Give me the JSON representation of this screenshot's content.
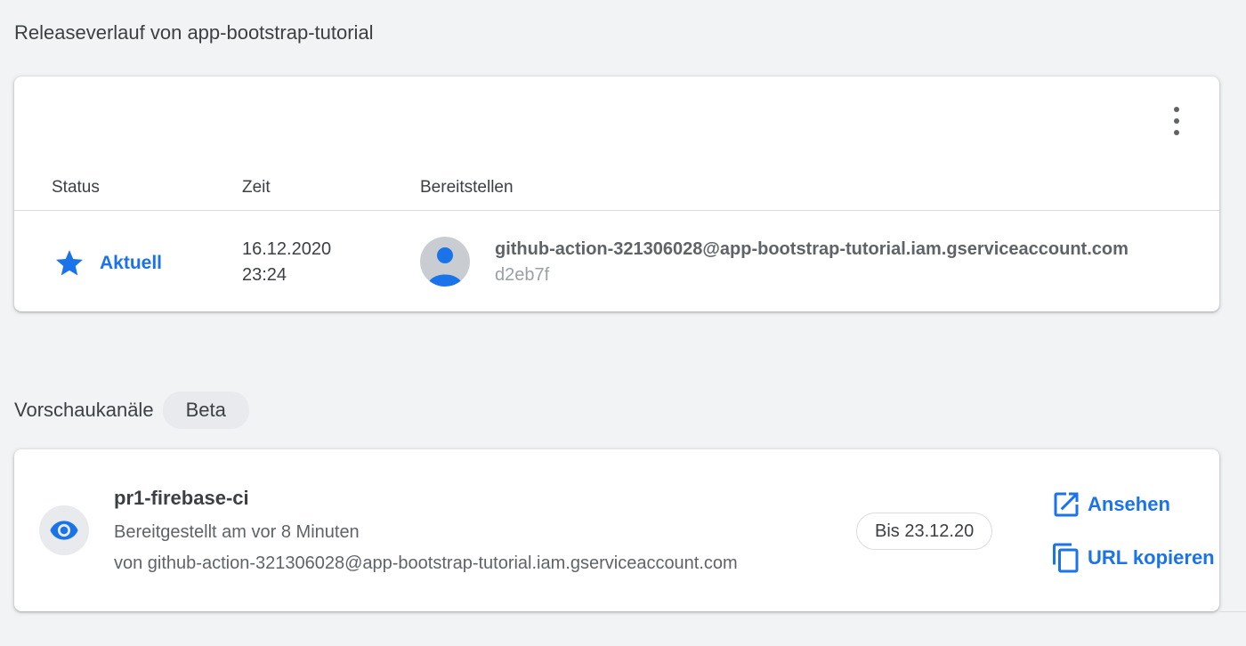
{
  "release_history": {
    "title": "Releaseverlauf von app-bootstrap-tutorial",
    "columns": {
      "status": "Status",
      "time": "Zeit",
      "deploy": "Bereitstellen"
    },
    "rows": [
      {
        "status": "Aktuell",
        "date": "16.12.2020",
        "time": "23:24",
        "account": "github-action-321306028@app-bootstrap-tutorial.iam.gserviceaccount.com",
        "hash": "d2eb7f"
      }
    ]
  },
  "preview_channels": {
    "title": "Vorschaukanäle",
    "badge": "Beta",
    "channels": [
      {
        "name": "pr1-firebase-ci",
        "deployed": "Bereitgestellt am vor 8 Minuten",
        "by": "von github-action-321306028@app-bootstrap-tutorial.iam.gserviceaccount.com",
        "expires": "Bis 23.12.20",
        "view_label": "Ansehen",
        "copy_label": "URL kopieren"
      }
    ]
  },
  "colors": {
    "accent": "#1a73e8",
    "background": "#f1f3f4",
    "card": "#ffffff"
  },
  "icons": {
    "status": "star-icon",
    "avatar": "account-icon",
    "channel": "eye-icon",
    "view": "open-in-new-icon",
    "copy": "copy-icon",
    "menu": "more-vert-icon"
  }
}
